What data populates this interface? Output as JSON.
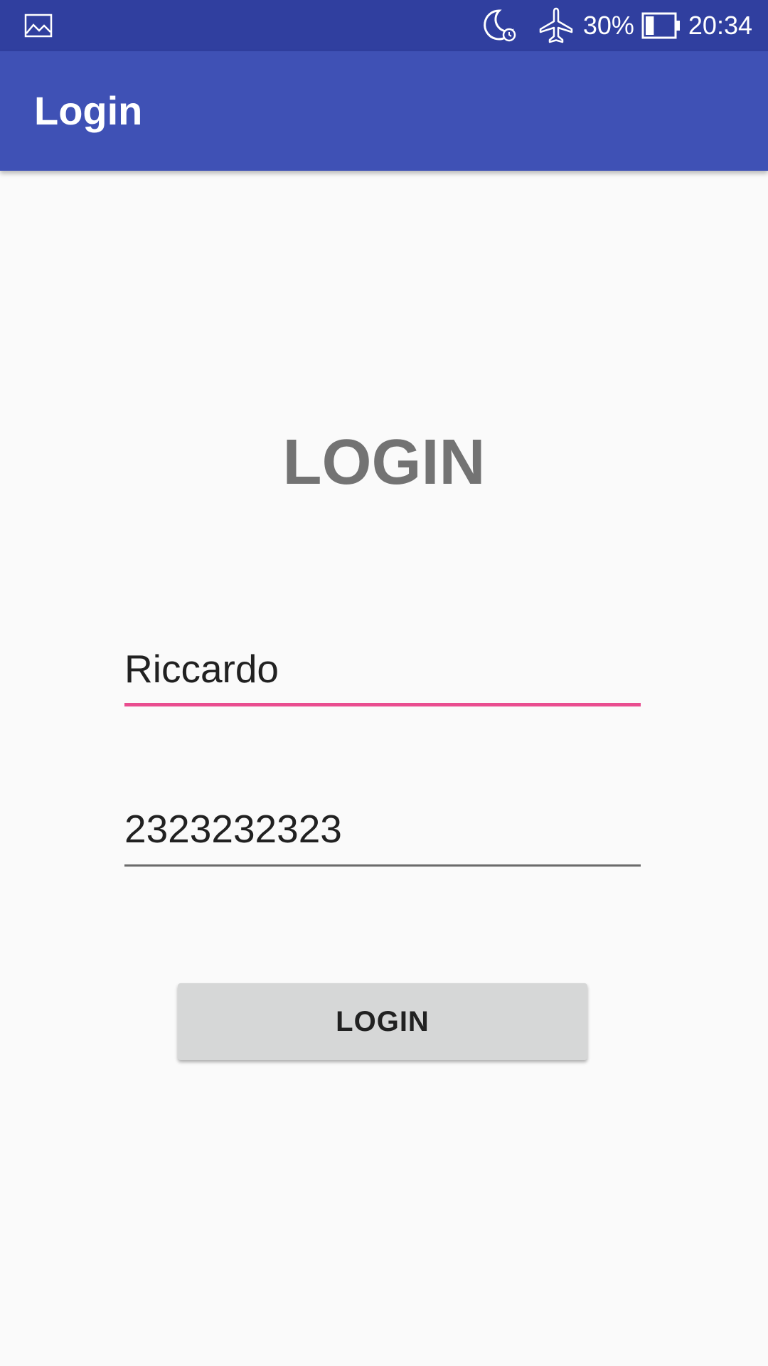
{
  "status_bar": {
    "left_icons": [
      "gallery-icon"
    ],
    "right_icons": [
      "do-not-disturb-alarm-icon",
      "airplane-mode-icon",
      "battery-icon"
    ],
    "battery_percent": "30%",
    "battery_level": 0.3,
    "time": "20:34",
    "background": "#303f9f"
  },
  "app_bar": {
    "title": "Login",
    "background": "#3f51b5"
  },
  "main": {
    "heading": "LOGIN",
    "username": {
      "value": "Riccardo",
      "focused": true,
      "accent": "#e94d8f"
    },
    "password": {
      "value": "2323232323"
    },
    "login_button": {
      "label": "LOGIN"
    }
  }
}
